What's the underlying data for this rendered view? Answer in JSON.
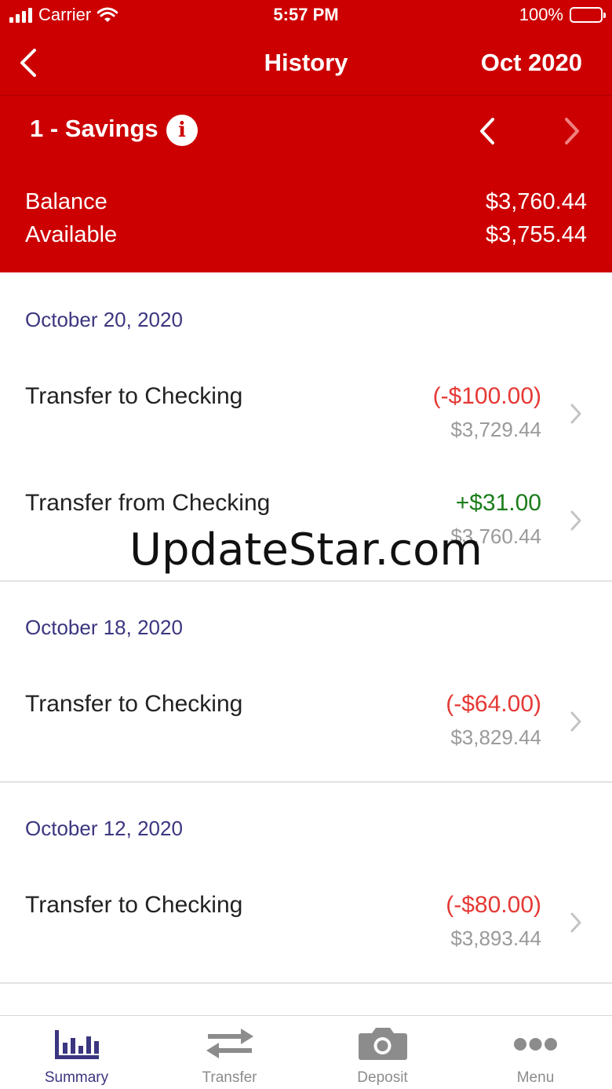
{
  "status_bar": {
    "carrier": "Carrier",
    "time": "5:57 PM",
    "battery": "100%"
  },
  "nav": {
    "title": "History",
    "month": "Oct 2020"
  },
  "account": {
    "name": "1 - Savings",
    "info_glyph": "i"
  },
  "balance": {
    "balance_label": "Balance",
    "balance_value": "$3,760.44",
    "available_label": "Available",
    "available_value": "$3,755.44"
  },
  "sections": [
    {
      "date": "October 20, 2020",
      "transactions": [
        {
          "description": "Transfer to Checking",
          "amount": "(-$100.00)",
          "running_balance": "$3,729.44",
          "type": "debit"
        },
        {
          "description": "Transfer from Checking",
          "amount": "+$31.00",
          "running_balance": "$3,760.44",
          "type": "credit"
        }
      ]
    },
    {
      "date": "October 18, 2020",
      "transactions": [
        {
          "description": "Transfer to Checking",
          "amount": "(-$64.00)",
          "running_balance": "$3,829.44",
          "type": "debit"
        }
      ]
    },
    {
      "date": "October 12, 2020",
      "transactions": [
        {
          "description": "Transfer to Checking",
          "amount": "(-$80.00)",
          "running_balance": "$3,893.44",
          "type": "debit"
        }
      ]
    }
  ],
  "watermark": "UpdateStar.com",
  "tabbar": {
    "tabs": [
      {
        "label": "Summary",
        "icon": "bar-chart-icon",
        "active": true
      },
      {
        "label": "Transfer",
        "icon": "transfer-arrows-icon",
        "active": false
      },
      {
        "label": "Deposit",
        "icon": "camera-icon",
        "active": false
      },
      {
        "label": "Menu",
        "icon": "more-dots-icon",
        "active": false
      }
    ]
  },
  "colors": {
    "brand_red": "#cc0000",
    "accent_purple": "#3b3680",
    "debit_red": "#e53935",
    "credit_green": "#1b7d1b",
    "muted_gray": "#9a9a9a"
  }
}
